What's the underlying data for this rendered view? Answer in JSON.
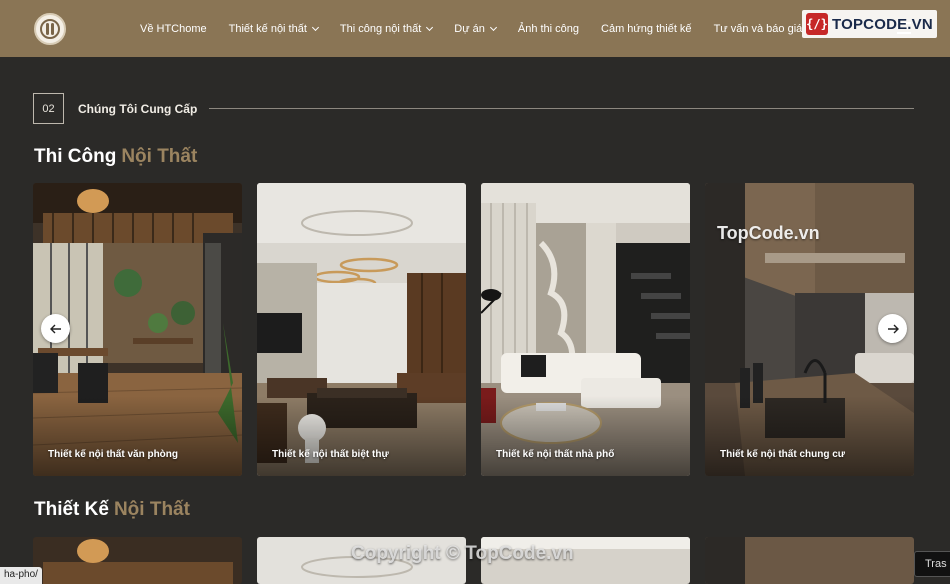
{
  "nav": {
    "items": [
      {
        "label": "Về HTChome",
        "dropdown": false
      },
      {
        "label": "Thiết kế nội thất",
        "dropdown": true
      },
      {
        "label": "Thi công nội thất",
        "dropdown": true
      },
      {
        "label": "Dự án",
        "dropdown": true
      },
      {
        "label": "Ảnh thi công",
        "dropdown": false
      },
      {
        "label": "Cảm hứng thiết kế",
        "dropdown": false
      },
      {
        "label": "Tư vấn và báo giá",
        "dropdown": false
      }
    ]
  },
  "watermark": {
    "logo_badge": "{/}",
    "logo_text": "TOPCODE.VN",
    "mid_text": "TopCode.vn",
    "copyright": "Copyright © TopCode.vn"
  },
  "section": {
    "number": "02",
    "title": "Chúng Tôi Cung Cấp"
  },
  "construction": {
    "heading_main": "Thi Công",
    "heading_accent": "Nội Thất",
    "cards": [
      {
        "caption": "Thiết kế nội thất văn phòng"
      },
      {
        "caption": "Thiết kế nội thất biệt thự"
      },
      {
        "caption": "Thiết kế nội thất nhà phố"
      },
      {
        "caption": "Thiết kế nội thất chung cư"
      }
    ]
  },
  "design": {
    "heading_main": "Thiết Kế",
    "heading_accent": "Nội Thất"
  },
  "status_bar": {
    "url_fragment": "ha-pho/"
  },
  "trash_button": {
    "label": "Tras"
  },
  "colors": {
    "header_bg": "#8a7555",
    "page_bg": "#2b2a28",
    "accent": "#9b8460"
  }
}
